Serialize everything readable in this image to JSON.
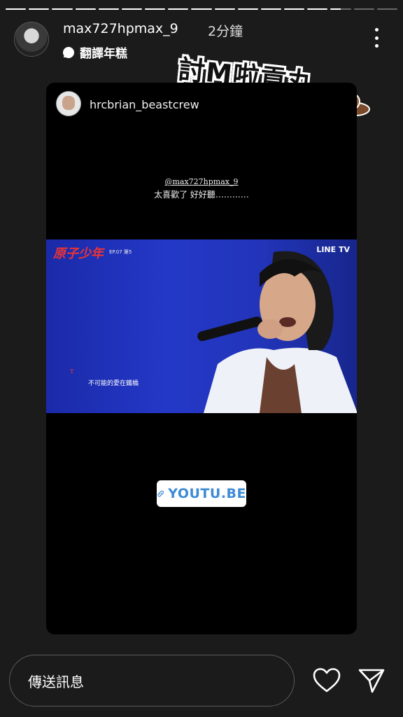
{
  "progress": [
    1,
    1,
    1,
    1,
    1,
    1,
    1,
    1,
    1,
    1,
    1,
    1,
    1,
    1,
    0.5,
    0,
    0
  ],
  "header": {
    "username": "max727hpmax_9",
    "time": "2分鐘",
    "subtitle": "翻譯年糕",
    "more_icon": "more-vertical-icon"
  },
  "sticker_text": "討M啦貢丸",
  "card": {
    "username": "hrcbrian_beastcrew",
    "mention": "@max727hpmax_9",
    "caption": "太喜歡了 好好聽…………",
    "video": {
      "show_logo": "原子少年",
      "info": "EP.07   第5",
      "brand": "LINE TV",
      "subtitle": "不可能的愛在鐵橋",
      "mark": "T"
    },
    "link_label": "YOUTU.BE"
  },
  "footer": {
    "message_placeholder": "傳送訊息",
    "like_icon": "heart-icon",
    "send_icon": "send-icon"
  },
  "colors": {
    "background": "#1b1b1b",
    "link": "#3d8bd6",
    "video_blue": "#2438c8"
  }
}
